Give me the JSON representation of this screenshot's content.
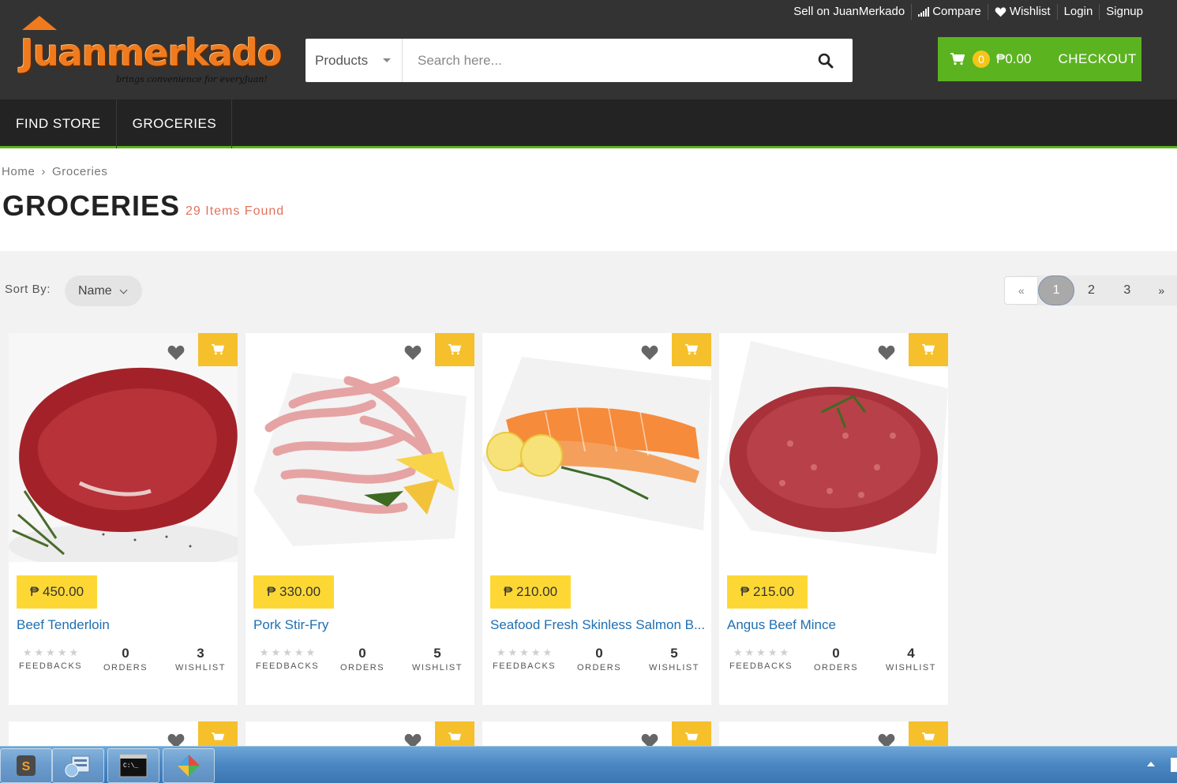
{
  "header": {
    "top_links": [
      {
        "label": "Sell on JuanMerkado",
        "icon": ""
      },
      {
        "label": "Compare",
        "icon": "bar-signal-icon"
      },
      {
        "label": "Wishlist",
        "icon": "heart-icon"
      },
      {
        "label": "Login",
        "icon": ""
      },
      {
        "label": "Signup",
        "icon": ""
      }
    ],
    "logo": {
      "text": "Juanmerkado",
      "tagline": "brings convenience for everyJuan!"
    },
    "search": {
      "category": "Products",
      "placeholder": "Search here...",
      "icon": "search-icon"
    },
    "cart": {
      "count": "0",
      "total": "₱0.00",
      "checkout_label": "CHECKOUT",
      "icon": "cart-icon"
    }
  },
  "nav": {
    "items": [
      "FIND STORE",
      "GROCERIES"
    ]
  },
  "breadcrumb": {
    "items": [
      "Home",
      "›",
      "Groceries"
    ]
  },
  "page": {
    "title": "GROCERIES",
    "items_found": "29 Items Found"
  },
  "toolbar": {
    "sort_label": "Sort By:",
    "sort_value": "Name",
    "pagination": {
      "prev": "«",
      "pages": [
        "1",
        "2",
        "3"
      ],
      "current": "1",
      "next": "»"
    }
  },
  "products": [
    {
      "price": "₱ 450.00",
      "name": "Beef Tenderloin",
      "feedbacks_label": "FEEDBACKS",
      "orders": "0",
      "orders_label": "ORDERS",
      "wishlist": "3",
      "wishlist_label": "WISHLIST",
      "rating": 0
    },
    {
      "price": "₱ 330.00",
      "name": "Pork Stir-Fry",
      "feedbacks_label": "FEEDBACKS",
      "orders": "0",
      "orders_label": "ORDERS",
      "wishlist": "5",
      "wishlist_label": "WISHLIST",
      "rating": 0
    },
    {
      "price": "₱ 210.00",
      "name": "Seafood Fresh Skinless Salmon B...",
      "feedbacks_label": "FEEDBACKS",
      "orders": "0",
      "orders_label": "ORDERS",
      "wishlist": "5",
      "wishlist_label": "WISHLIST",
      "rating": 0
    },
    {
      "price": "₱ 215.00",
      "name": "Angus Beef Mince",
      "feedbacks_label": "FEEDBACKS",
      "orders": "0",
      "orders_label": "ORDERS",
      "wishlist": "4",
      "wishlist_label": "WISHLIST",
      "rating": 0
    }
  ],
  "colors": {
    "accent_green": "#5cb320",
    "price_yellow": "#fdd835",
    "cart_yellow": "#f5c02b",
    "link_blue": "#1f6fb2",
    "header_dark": "#333333"
  },
  "taskbar": {
    "apps": [
      "sublime-text-icon",
      "server-manager-icon",
      "command-prompt-icon",
      "app-diamond-icon"
    ]
  }
}
